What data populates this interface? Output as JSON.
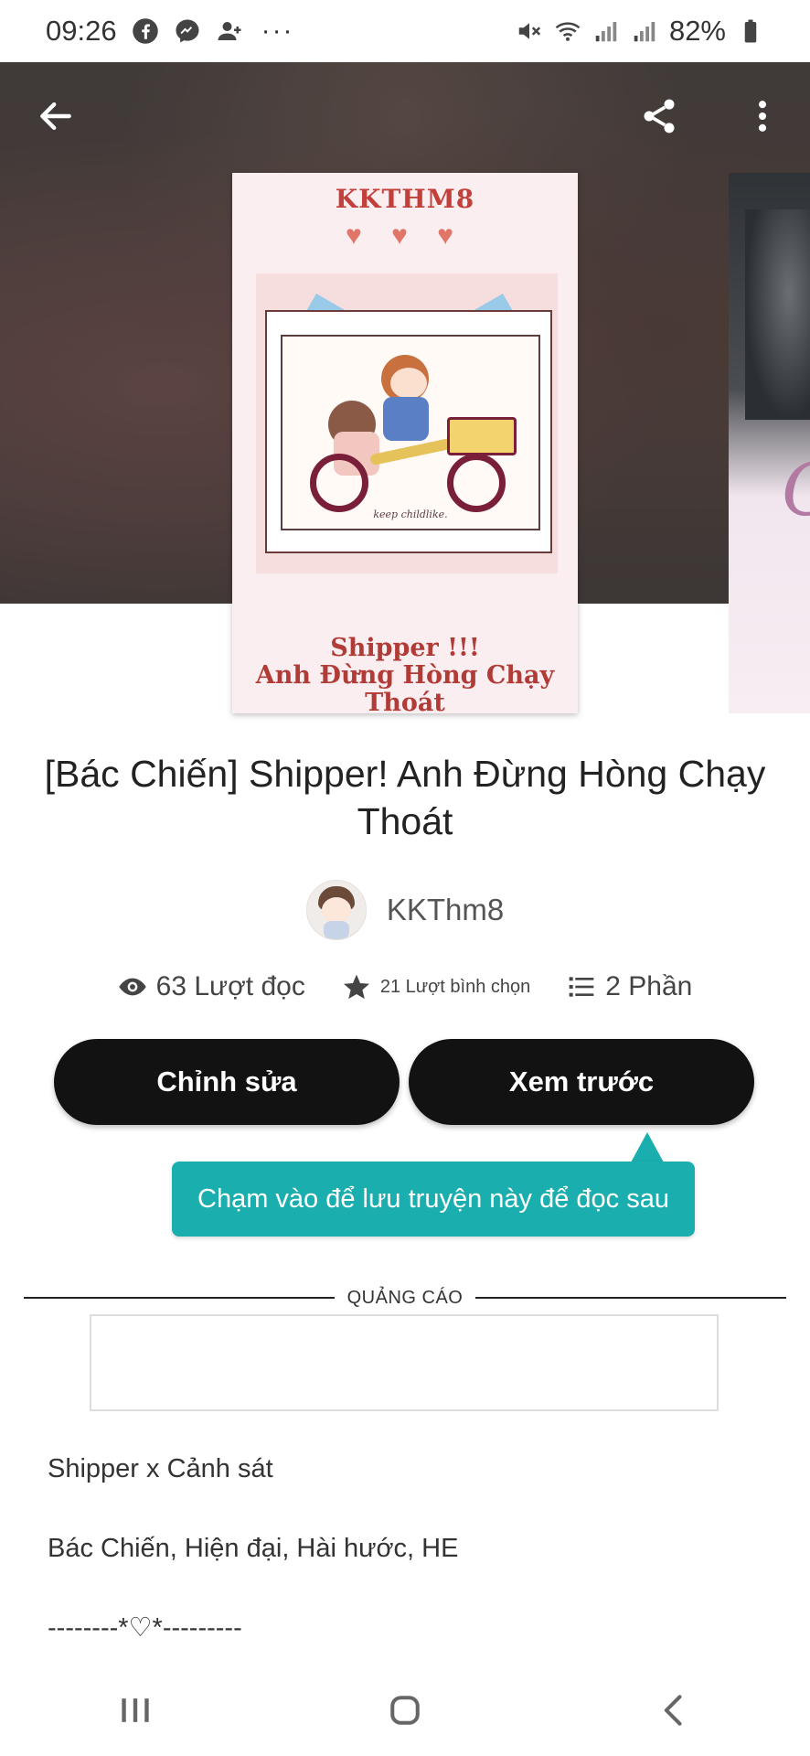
{
  "status_bar": {
    "time": "09:26",
    "battery": "82%",
    "icons": [
      "facebook-icon",
      "messenger-icon",
      "person-add-icon",
      "more-dots",
      "mute-icon",
      "wifi-icon",
      "signal-icon",
      "signal-icon",
      "battery-icon"
    ]
  },
  "header": {
    "back_icon": "arrow-left-icon",
    "share_icon": "share-icon",
    "more_icon": "more-vertical-icon"
  },
  "cover": {
    "top_text": "KKTHM8",
    "hearts": "♥ ♥ ♥",
    "small_caption": "keep childlike.",
    "bottom_line1": "Shipper !!!",
    "bottom_line2": "Anh Đừng Hòng Chạy Thoát"
  },
  "story": {
    "title": "[Bác Chiến] Shipper! Anh Đừng Hòng Chạy Thoát",
    "author": "KKThm8"
  },
  "stats": {
    "reads": "63 Lượt đọc",
    "votes": "21 Lượt bình chọn",
    "parts": "2 Phần"
  },
  "actions": {
    "edit_label": "Chỉnh sửa",
    "preview_label": "Xem trước"
  },
  "tooltip": {
    "text": "Chạm vào để lưu truyện này để đọc sau"
  },
  "ad": {
    "label": "QUẢNG CÁO"
  },
  "description": {
    "lines": [
      "Shipper x Cảnh sát",
      "Bác Chiến, Hiện đại, Hài hước, HE",
      "--------*♡*---------"
    ]
  },
  "colors": {
    "button_bg": "#121212",
    "tooltip_bg": "#1aaeae",
    "cover_title": "#c23f3a"
  }
}
